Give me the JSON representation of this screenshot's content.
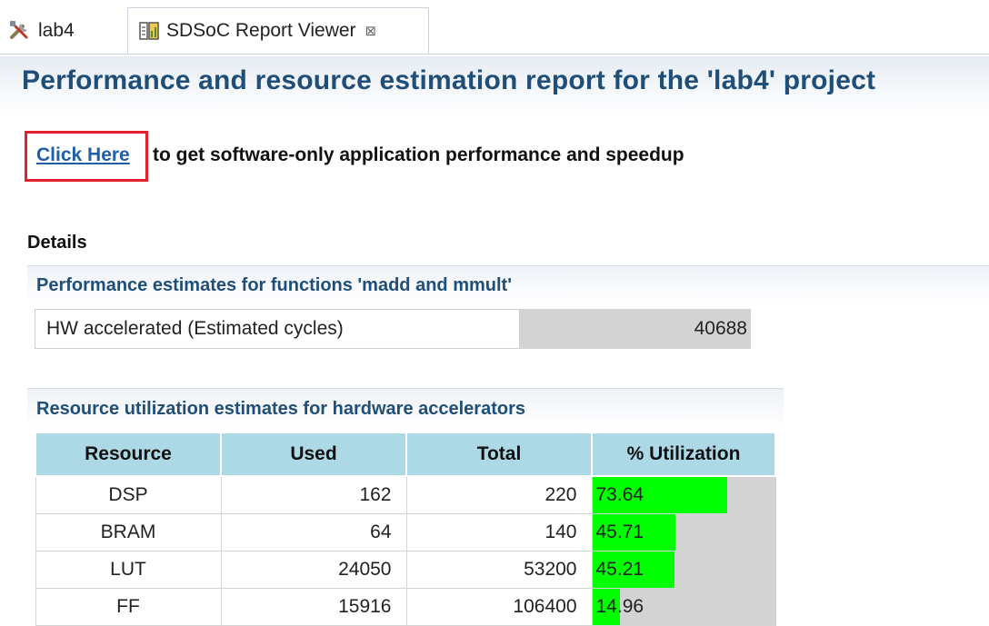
{
  "tabs": [
    {
      "label": "lab4",
      "icon": "tools-icon"
    },
    {
      "label": "SDSoC Report Viewer",
      "icon": "report-icon",
      "close": "⊠"
    }
  ],
  "report": {
    "title": "Performance and resource estimation report for the 'lab4' project",
    "link_text": "Click Here",
    "link_rest": "to get software-only application performance and speedup",
    "details_heading": "Details"
  },
  "performance": {
    "heading": "Performance estimates for functions 'madd and mmult'",
    "label": "HW accelerated (Estimated cycles)",
    "value": "40688"
  },
  "resources": {
    "heading": "Resource utilization estimates for hardware accelerators",
    "columns": [
      "Resource",
      "Used",
      "Total",
      "% Utilization"
    ],
    "rows": [
      {
        "resource": "DSP",
        "used": "162",
        "total": "220",
        "util": "73.64"
      },
      {
        "resource": "BRAM",
        "used": "64",
        "total": "140",
        "util": "45.71"
      },
      {
        "resource": "LUT",
        "used": "24050",
        "total": "53200",
        "util": "45.21"
      },
      {
        "resource": "FF",
        "used": "15916",
        "total": "106400",
        "util": "14.96"
      }
    ]
  },
  "colors": {
    "title": "#1f4e79",
    "link": "#1f5fa8",
    "highlight_border": "#e0202c",
    "table_header": "#add8e6",
    "util_bar": "#00ff00",
    "util_track": "#d3d3d3"
  }
}
